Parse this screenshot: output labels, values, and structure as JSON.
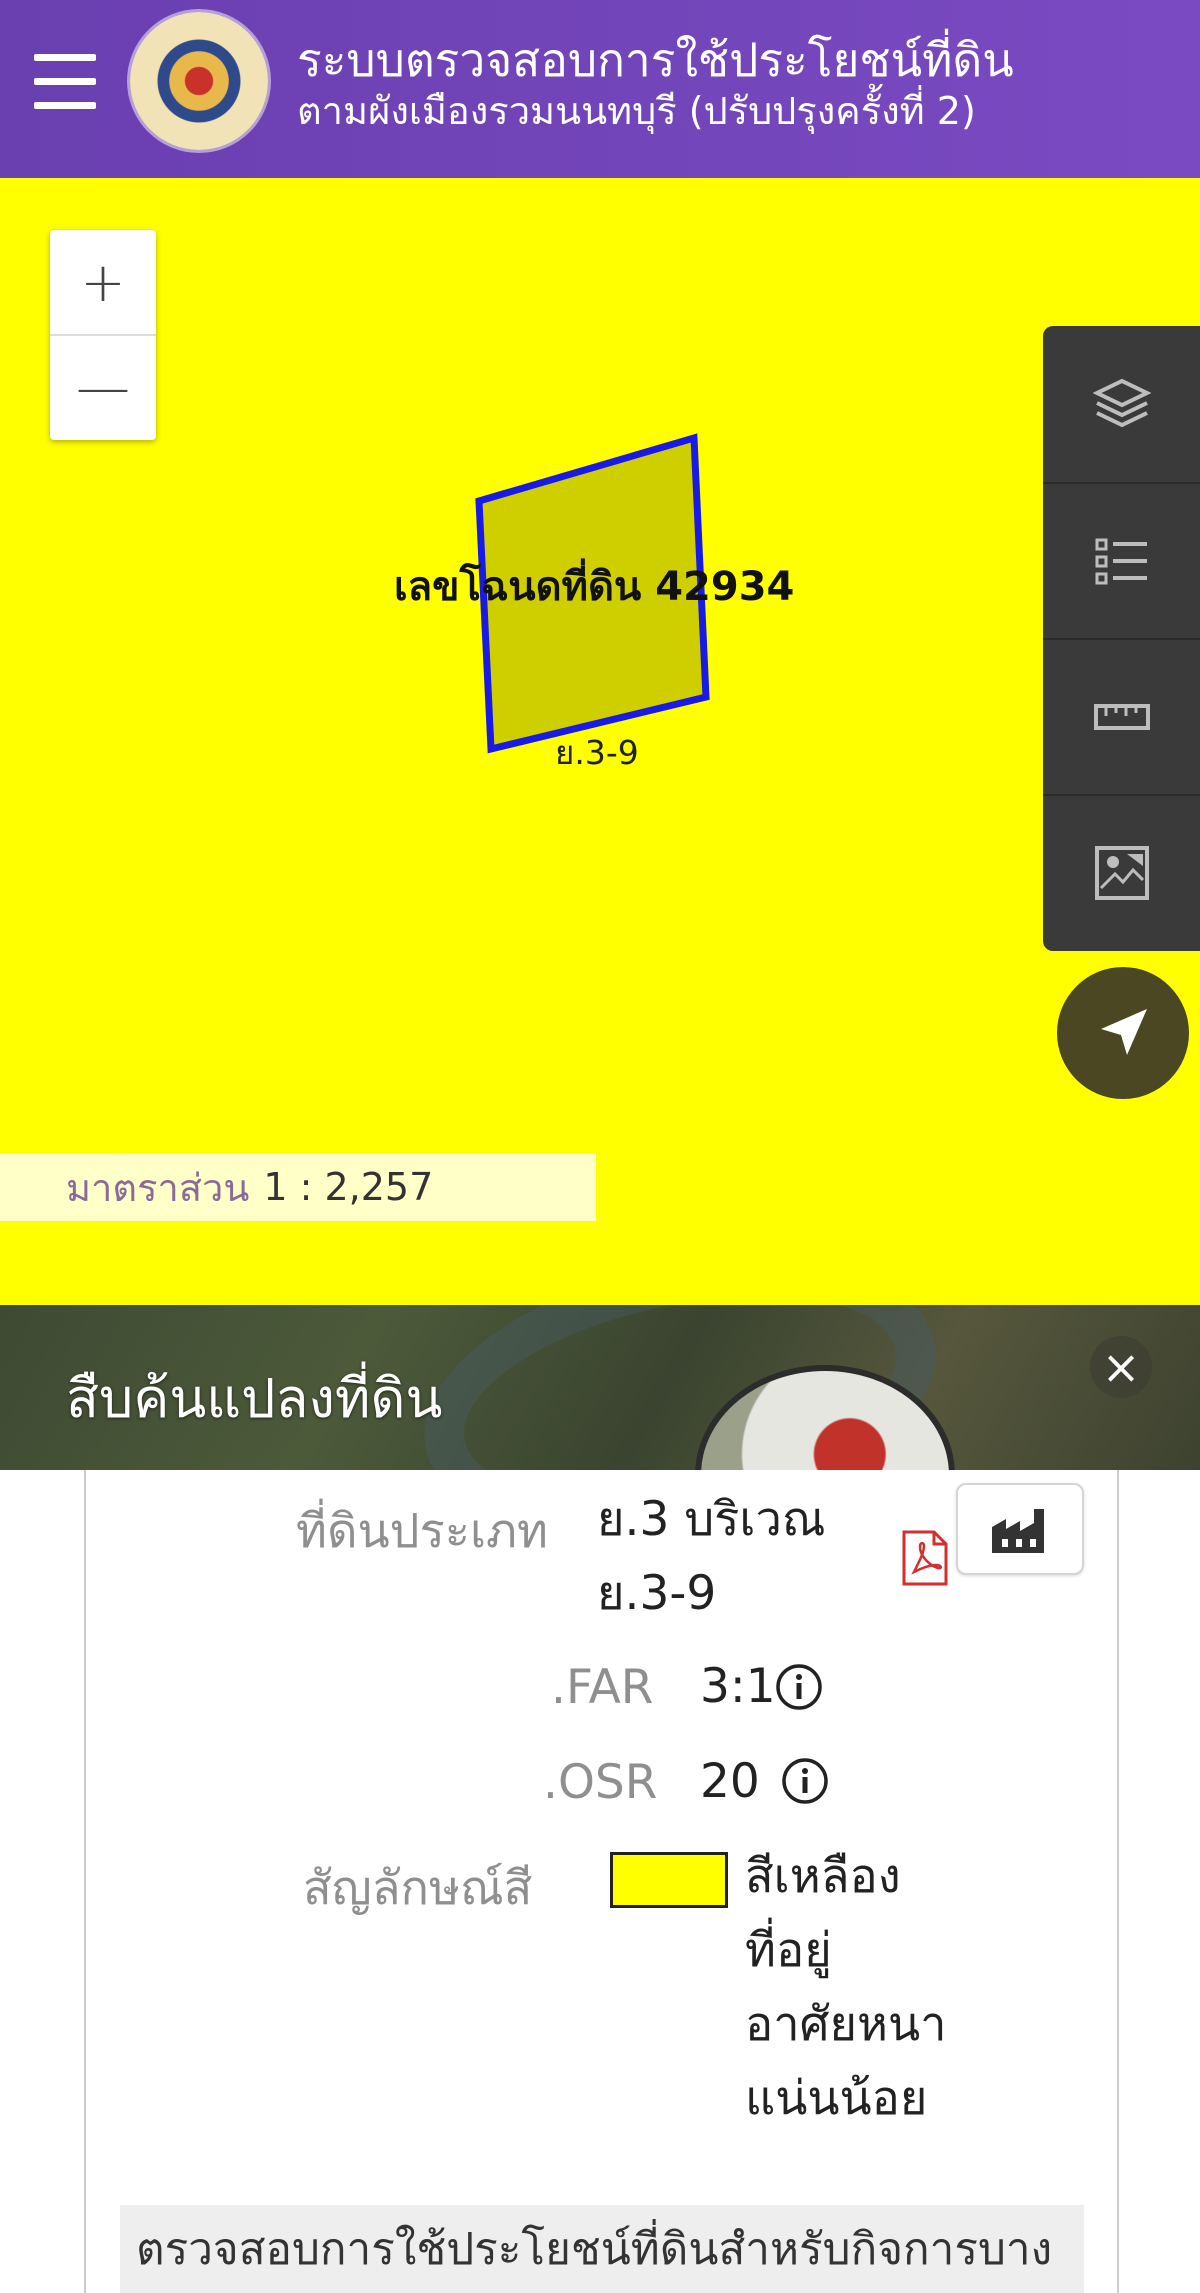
{
  "header": {
    "title_line1": "ระบบตรวจสอบการใช้ประโยชน์ที่ดิน",
    "title_line2": "ตามผังเมืองรวมนนทบุรี (ปรับปรุงครั้งที่ 2)",
    "menu_icon": "hamburger-menu-icon",
    "logo_icon": "province-seal-logo"
  },
  "map": {
    "zoom_in_label": "+",
    "zoom_out_label": "—",
    "parcel_label": "เลขโฉนดที่ดิน 42934",
    "zone_label": "ย.3-9",
    "background_color": "#ffff00",
    "parcel_fill": "#cfcf00",
    "parcel_stroke": "#1a1ae6",
    "tools": [
      "layers-icon",
      "legend-list-icon",
      "measure-ruler-icon",
      "basemap-icon"
    ],
    "locate_icon": "navigation-arrow-icon",
    "scale_label": "มาตราส่วน",
    "scale_value": "1 : 2,257"
  },
  "panel": {
    "title": "สืบค้นแปลงที่ดิน",
    "close_label": "×"
  },
  "details": {
    "land_type_label": "ที่ดินประเภท",
    "land_type_line1": "ย.3 บริเวณ",
    "land_type_line2": "ย.3-9",
    "far_label": ".FAR",
    "far_value": "3:1",
    "osr_label": ".OSR",
    "osr_value": "20",
    "color_label": "สัญลักษณ์สี",
    "color_swatch": "#ffff00",
    "color_desc_line1": "สีเหลือง",
    "color_desc_line2": "ที่อยู่",
    "color_desc_line3": "อาศัยหนา",
    "color_desc_line4": "แน่นน้อย",
    "check_activity": "ตรวจสอบการใช้ประโยชน์ที่ดินสำหรับกิจการบาง"
  }
}
